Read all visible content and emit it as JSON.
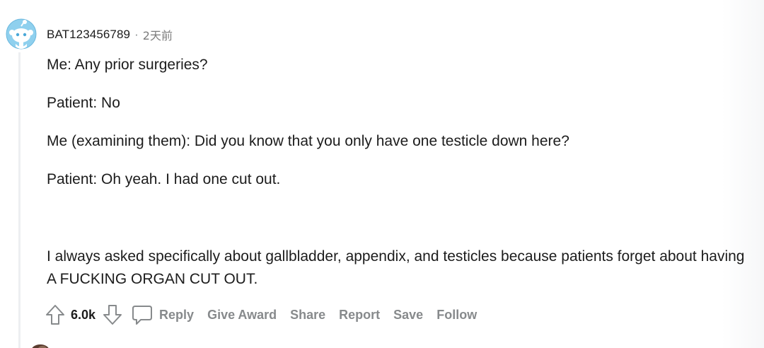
{
  "comment": {
    "username": "BAT123456789",
    "separator": "·",
    "time": "2天前",
    "paragraphs": [
      "Me: Any prior surgeries?",
      "Patient: No",
      "Me (examining them): Did you know that you only have one testicle down here?",
      "Patient: Oh yeah. I had one cut out.",
      "I always asked specifically about gallbladder, appendix, and testicles because patients forget about having A FUCKING ORGAN CUT OUT."
    ],
    "score": "6.0k",
    "actions": {
      "reply": "Reply",
      "give_award": "Give Award",
      "share": "Share",
      "report": "Report",
      "save": "Save",
      "follow": "Follow"
    }
  },
  "colors": {
    "avatar_blue": "#7fc6e8",
    "text_dark": "#1c1c1c",
    "text_muted": "#878a8c",
    "thread_line": "#edeff1"
  },
  "icons": {
    "avatar": "snoo-avatar-icon",
    "upvote": "upvote-arrow-icon",
    "downvote": "downvote-arrow-icon",
    "reply": "speech-bubble-icon"
  }
}
